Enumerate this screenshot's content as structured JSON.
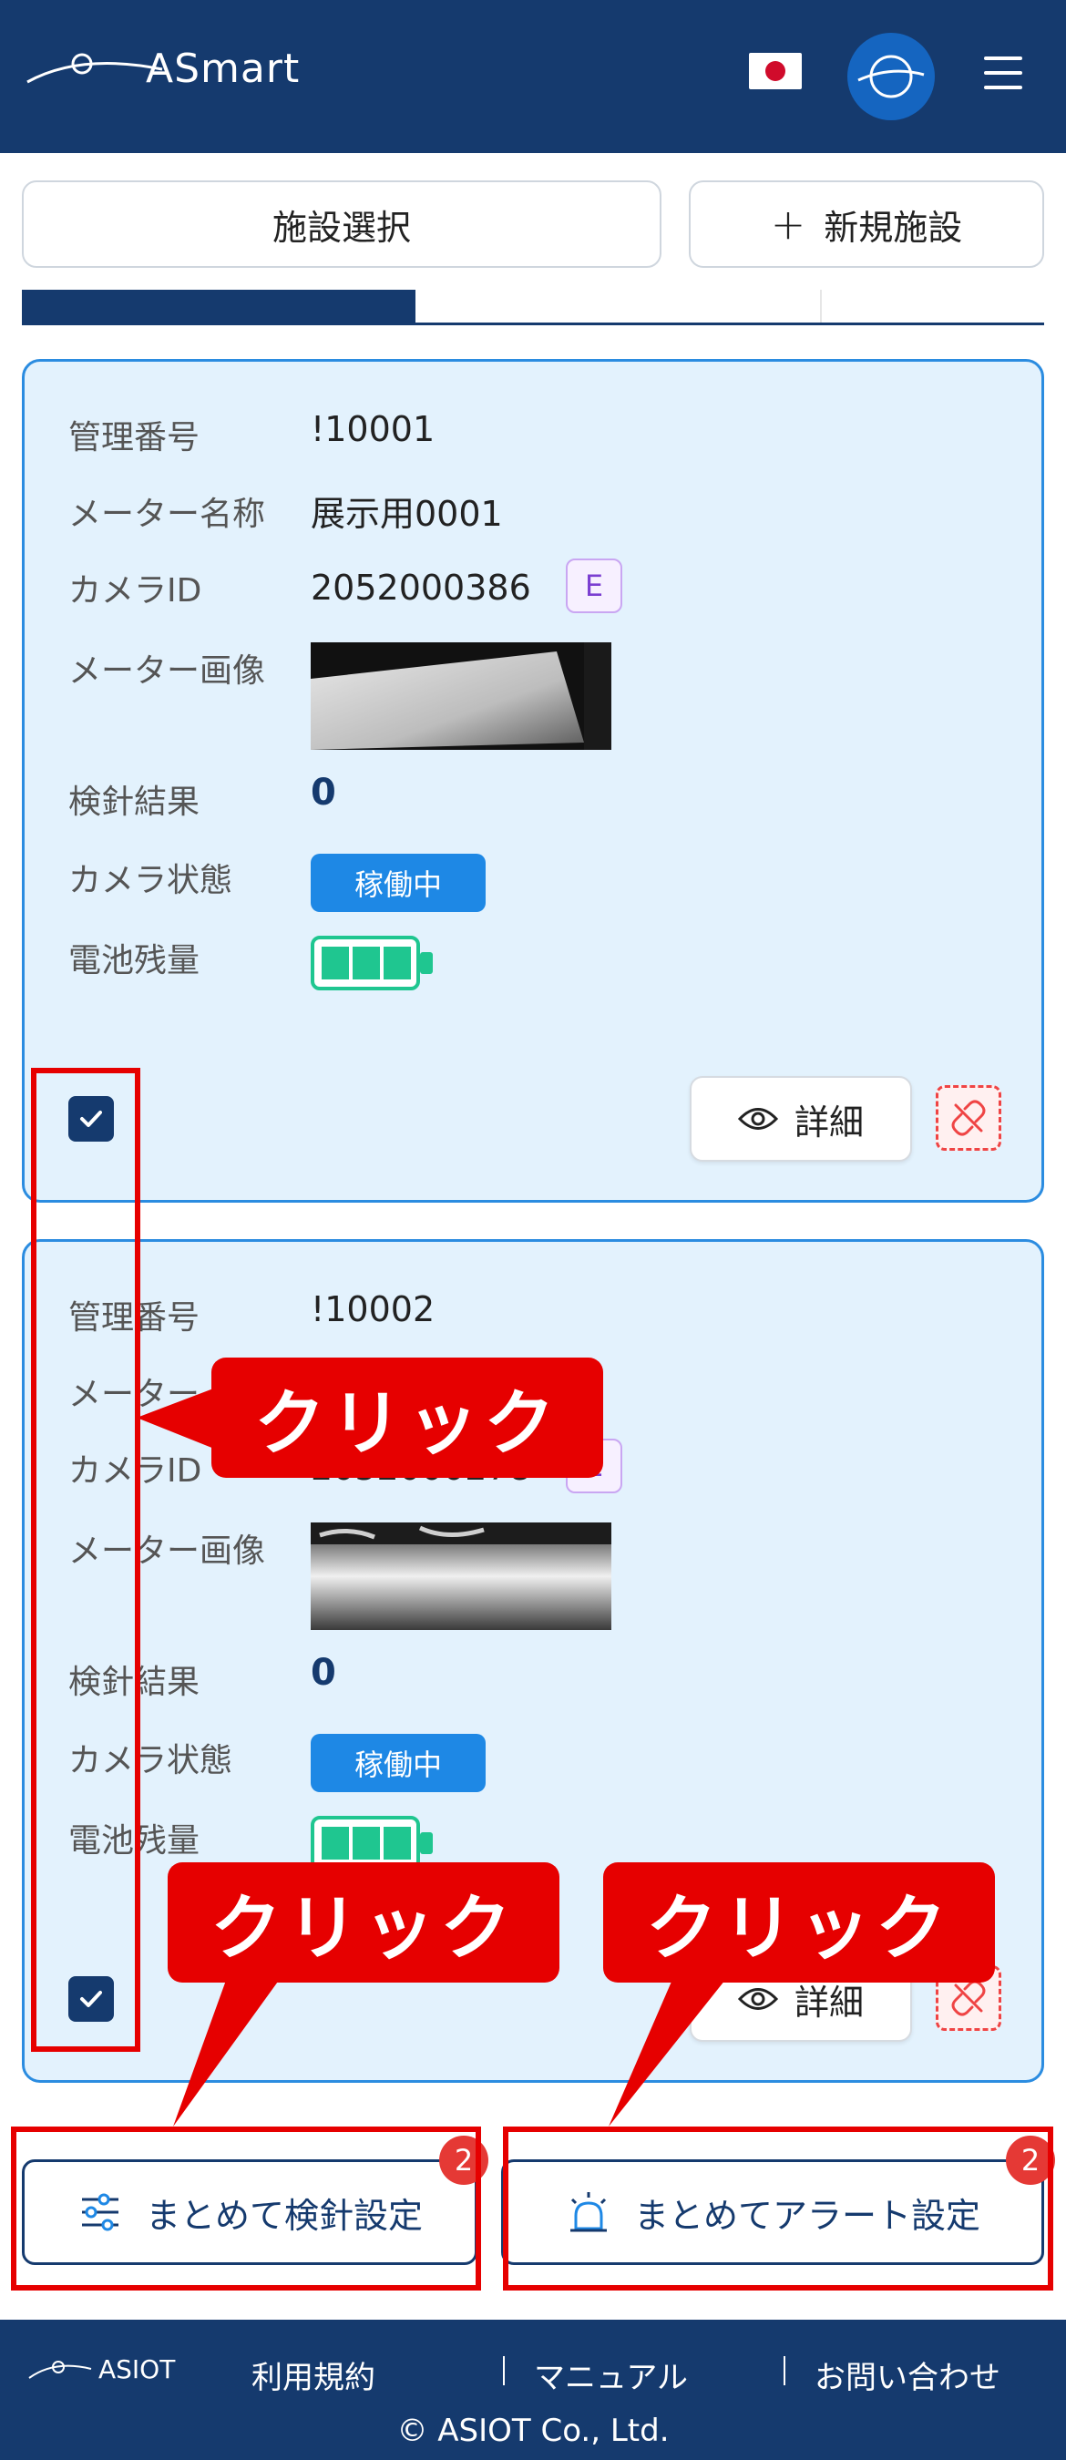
{
  "header": {
    "logo_text": "ASmart",
    "language_flag": "japan-flag-icon",
    "avatar_icon": "globe-logo-icon",
    "menu_icon": "hamburger-menu-icon"
  },
  "toolbar": {
    "select_facility_label": "施設選択",
    "new_facility_icon": "+",
    "new_facility_label": "新規施設"
  },
  "cards": [
    {
      "labels": {
        "management_number": "管理番号",
        "meter_name": "メーター名称",
        "camera_id": "カメラID",
        "meter_image": "メーター画像",
        "reading_result": "検針結果",
        "camera_status": "カメラ状態",
        "battery": "電池残量"
      },
      "management_number": "!10001",
      "meter_name": "展示用0001",
      "camera_id": "2052000386",
      "camera_badge": "E",
      "reading_result": "0",
      "camera_status": "稼働中",
      "battery_level": 1.0,
      "checked": true,
      "detail_label": "詳細"
    },
    {
      "labels": {
        "management_number": "管理番号",
        "meter_name": "メーター",
        "camera_id": "カメラID",
        "meter_image": "メーター画像",
        "reading_result": "検針結果",
        "camera_status": "カメラ状態",
        "battery": "電池残量"
      },
      "management_number": "!10002",
      "meter_name": "",
      "camera_id": "2052000278",
      "camera_badge": "E",
      "reading_result": "0",
      "camera_status": "稼働中",
      "battery_level": 1.0,
      "checked": true,
      "detail_label": "詳細"
    }
  ],
  "bulk_actions": {
    "reading_settings_label": "まとめて検針設定",
    "reading_settings_count": "2",
    "alert_settings_label": "まとめてアラート設定",
    "alert_settings_count": "2"
  },
  "footer": {
    "brand": "ASIOT",
    "terms": "利用規約",
    "manual": "マニュアル",
    "contact": "お問い合わせ",
    "copyright": "© ASIOT Co., Ltd."
  },
  "annotations": {
    "click_1": "クリック",
    "click_2": "クリック",
    "click_3": "クリック"
  },
  "colors": {
    "brand_navy": "#153a6e",
    "card_bg": "#e3f2fd",
    "status_blue": "#1e88e5",
    "battery_green": "#1fc690",
    "annotation_red": "#e60000"
  }
}
